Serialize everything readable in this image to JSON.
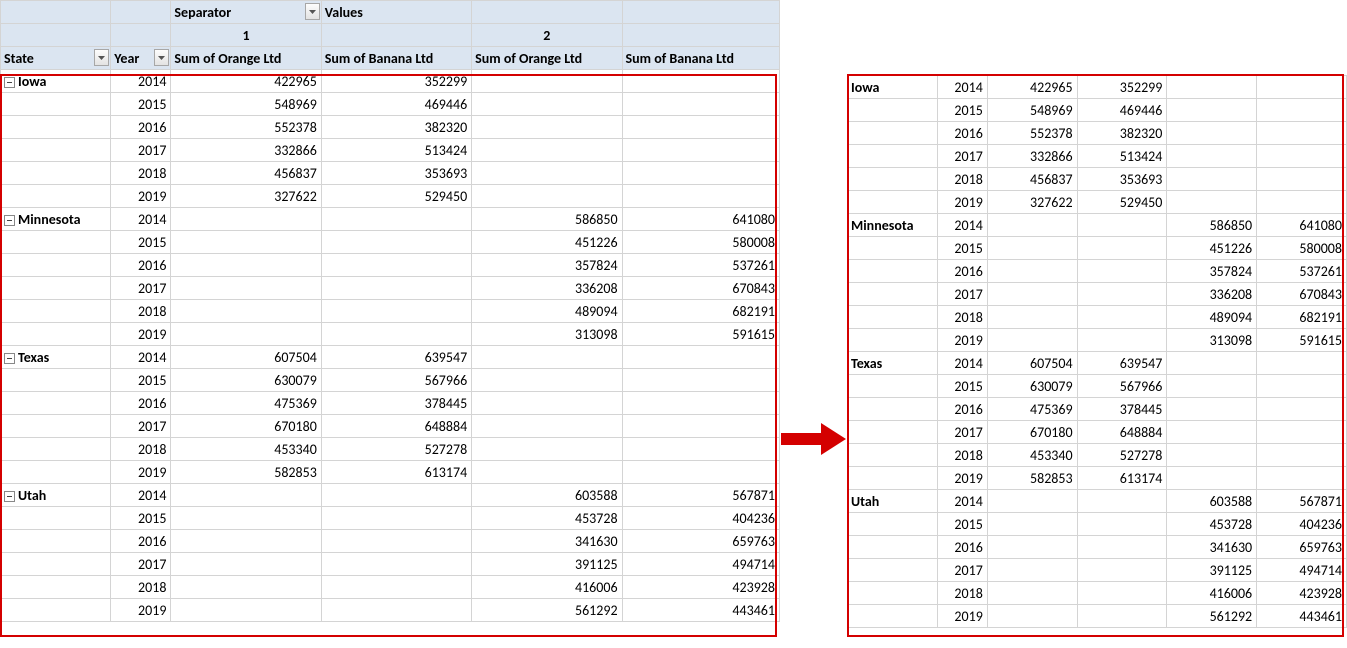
{
  "headers": {
    "separator": "Separator",
    "values": "Values",
    "group1": "1",
    "group2": "2",
    "state": "State",
    "year": "Year",
    "orange": "Sum of Orange Ltd",
    "banana": "Sum of Banana Ltd"
  },
  "states": [
    "Iowa",
    "Minnesota",
    "Texas",
    "Utah"
  ],
  "rows": [
    {
      "state": "Iowa",
      "year": "2014",
      "o1": "422965",
      "b1": "352299",
      "o2": "",
      "b2": ""
    },
    {
      "state": "",
      "year": "2015",
      "o1": "548969",
      "b1": "469446",
      "o2": "",
      "b2": ""
    },
    {
      "state": "",
      "year": "2016",
      "o1": "552378",
      "b1": "382320",
      "o2": "",
      "b2": ""
    },
    {
      "state": "",
      "year": "2017",
      "o1": "332866",
      "b1": "513424",
      "o2": "",
      "b2": ""
    },
    {
      "state": "",
      "year": "2018",
      "o1": "456837",
      "b1": "353693",
      "o2": "",
      "b2": ""
    },
    {
      "state": "",
      "year": "2019",
      "o1": "327622",
      "b1": "529450",
      "o2": "",
      "b2": ""
    },
    {
      "state": "Minnesota",
      "year": "2014",
      "o1": "",
      "b1": "",
      "o2": "586850",
      "b2": "641080"
    },
    {
      "state": "",
      "year": "2015",
      "o1": "",
      "b1": "",
      "o2": "451226",
      "b2": "580008"
    },
    {
      "state": "",
      "year": "2016",
      "o1": "",
      "b1": "",
      "o2": "357824",
      "b2": "537261"
    },
    {
      "state": "",
      "year": "2017",
      "o1": "",
      "b1": "",
      "o2": "336208",
      "b2": "670843"
    },
    {
      "state": "",
      "year": "2018",
      "o1": "",
      "b1": "",
      "o2": "489094",
      "b2": "682191"
    },
    {
      "state": "",
      "year": "2019",
      "o1": "",
      "b1": "",
      "o2": "313098",
      "b2": "591615"
    },
    {
      "state": "Texas",
      "year": "2014",
      "o1": "607504",
      "b1": "639547",
      "o2": "",
      "b2": ""
    },
    {
      "state": "",
      "year": "2015",
      "o1": "630079",
      "b1": "567966",
      "o2": "",
      "b2": ""
    },
    {
      "state": "",
      "year": "2016",
      "o1": "475369",
      "b1": "378445",
      "o2": "",
      "b2": ""
    },
    {
      "state": "",
      "year": "2017",
      "o1": "670180",
      "b1": "648884",
      "o2": "",
      "b2": ""
    },
    {
      "state": "",
      "year": "2018",
      "o1": "453340",
      "b1": "527278",
      "o2": "",
      "b2": ""
    },
    {
      "state": "",
      "year": "2019",
      "o1": "582853",
      "b1": "613174",
      "o2": "",
      "b2": ""
    },
    {
      "state": "Utah",
      "year": "2014",
      "o1": "",
      "b1": "",
      "o2": "603588",
      "b2": "567871"
    },
    {
      "state": "",
      "year": "2015",
      "o1": "",
      "b1": "",
      "o2": "453728",
      "b2": "404236"
    },
    {
      "state": "",
      "year": "2016",
      "o1": "",
      "b1": "",
      "o2": "341630",
      "b2": "659763"
    },
    {
      "state": "",
      "year": "2017",
      "o1": "",
      "b1": "",
      "o2": "391125",
      "b2": "494714"
    },
    {
      "state": "",
      "year": "2018",
      "o1": "",
      "b1": "",
      "o2": "416006",
      "b2": "423928"
    },
    {
      "state": "",
      "year": "2019",
      "o1": "",
      "b1": "",
      "o2": "561292",
      "b2": "443461"
    }
  ]
}
